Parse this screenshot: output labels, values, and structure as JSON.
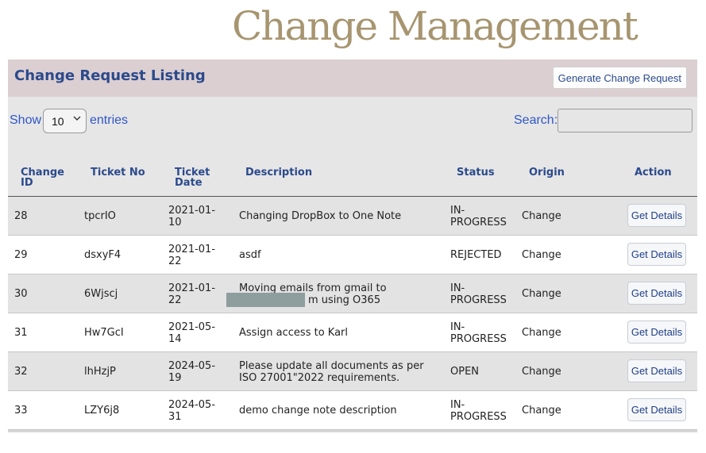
{
  "page": {
    "title": "Change Management"
  },
  "panel": {
    "title": "Change Request Listing",
    "generate_button": "Generate Change Request",
    "show_label": "Show",
    "entries_value": "10",
    "entries_label": "entries",
    "search_label": "Search:",
    "search_value": ""
  },
  "table": {
    "columns": {
      "change_id": "Change ID",
      "ticket_no": "Ticket No",
      "ticket_date": "Ticket Date",
      "description": "Description",
      "status": "Status",
      "origin": "Origin",
      "action": "Action"
    },
    "rows": [
      {
        "change_id": "28",
        "ticket_no": "tpcrIO",
        "date_a": "2021-01-",
        "date_b": "10",
        "desc": "Changing DropBox to One Note",
        "status_a": "IN-",
        "status_b": "PROGRESS",
        "origin": "Change",
        "action": "Get Details"
      },
      {
        "change_id": "29",
        "ticket_no": "dsxyF4",
        "date_a": "2021-01-",
        "date_b": "22",
        "desc": "asdf",
        "status": "REJECTED",
        "origin": "Change",
        "action": "Get Details"
      },
      {
        "change_id": "30",
        "ticket_no": "6Wjscj",
        "date_a": "2021-01-",
        "date_b": "22",
        "desc_a": "Moving emails from gmail to",
        "desc_b": "m using O365",
        "status_a": "IN-",
        "status_b": "PROGRESS",
        "origin": "Change",
        "action": "Get Details"
      },
      {
        "change_id": "31",
        "ticket_no": "Hw7GcI",
        "date_a": "2021-05-",
        "date_b": "14",
        "desc": "Assign access to Karl",
        "status_a": "IN-",
        "status_b": "PROGRESS",
        "origin": "Change",
        "action": "Get Details"
      },
      {
        "change_id": "32",
        "ticket_no": "lhHzjP",
        "date_a": "2024-05-",
        "date_b": "19",
        "desc_a": "Please update all documents as per",
        "desc_b": "ISO 27001\"2022 requirements.",
        "status": "OPEN",
        "origin": "Change",
        "action": "Get Details"
      },
      {
        "change_id": "33",
        "ticket_no": "LZY6j8",
        "date_a": "2024-05-",
        "date_b": "31",
        "desc": "demo change note description",
        "status_a": "IN-",
        "status_b": "PROGRESS",
        "origin": "Change",
        "action": "Get Details"
      }
    ]
  },
  "colors": {
    "title": "#a79570",
    "header_bg": "#dccfd1",
    "accent": "#2b4a8c",
    "link": "#2f56c7"
  }
}
